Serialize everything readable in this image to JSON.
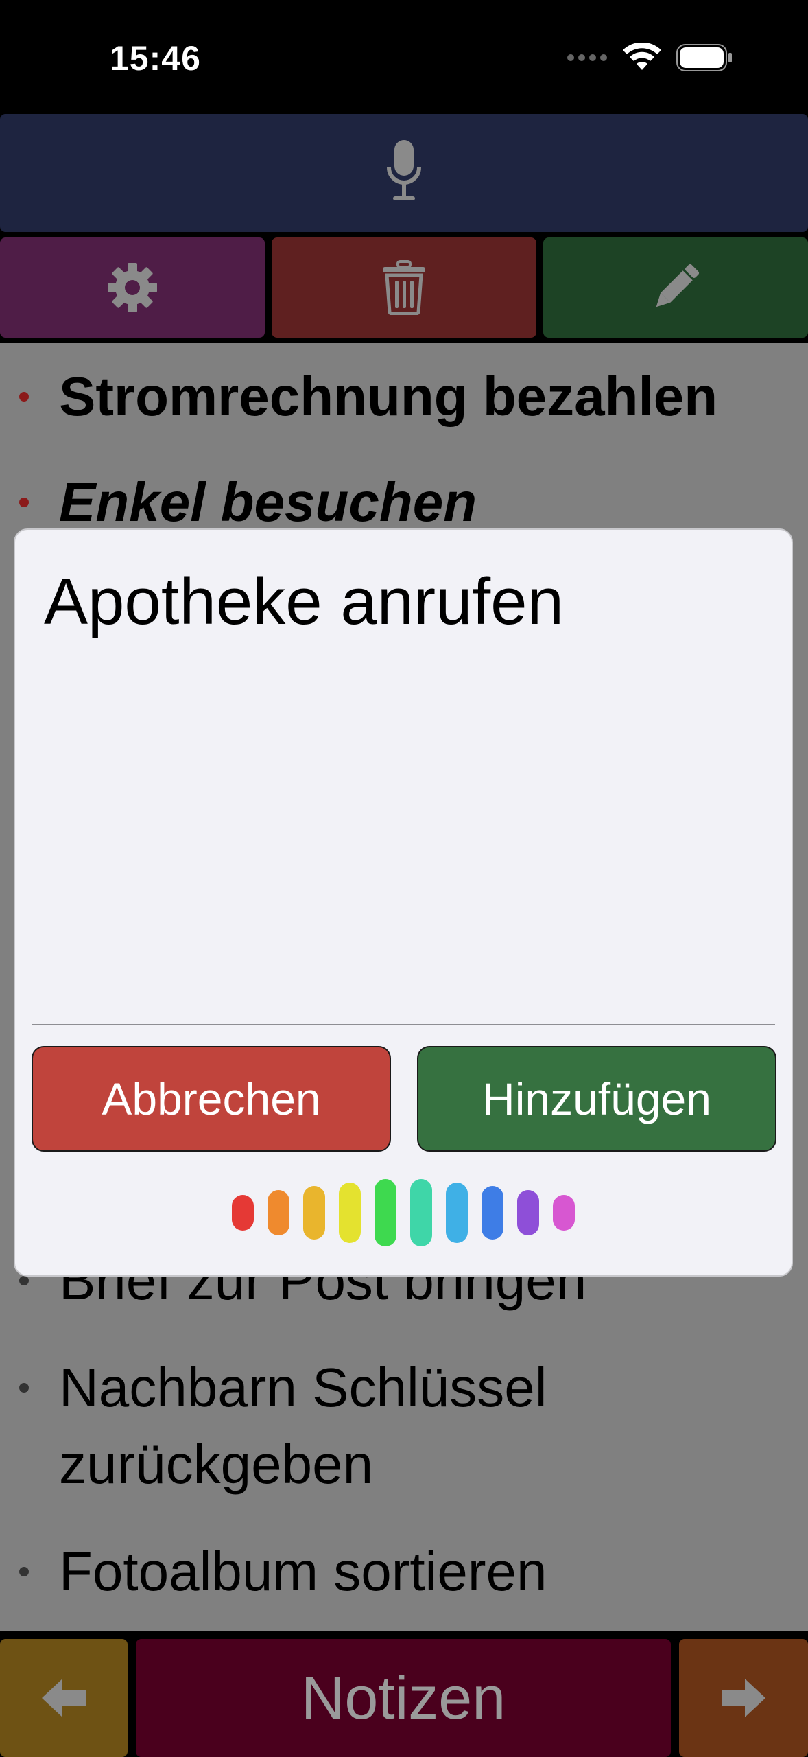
{
  "status": {
    "time": "15:46"
  },
  "toolbar": {
    "mic_icon": "microphone-icon",
    "settings_icon": "gear-icon",
    "trash_icon": "trash-icon",
    "edit_icon": "pencil-icon"
  },
  "notes": [
    {
      "text": "Stromrechnung bezahlen",
      "bullet_color": "#8b1a1a"
    },
    {
      "text": "Enkel besuchen",
      "bullet_color": "#8b1a1a"
    },
    {
      "text": "Brief zur Post bringen",
      "bullet_color": "#333333"
    },
    {
      "text": "Nachbarn Schlüssel zurückgeben",
      "bullet_color": "#333333"
    },
    {
      "text": "Fotoalbum sortieren",
      "bullet_color": "#333333"
    }
  ],
  "dialog": {
    "input_value": "Apotheke anrufen",
    "cancel_label": "Abbrechen",
    "add_label": "Hinzufügen",
    "wave_colors": [
      "#e53935",
      "#ef8a2e",
      "#e9b52d",
      "#e4e22f",
      "#3ed94f",
      "#3fd6a8",
      "#3fb0e6",
      "#3e7de6",
      "#8e4fd8",
      "#d757d1"
    ]
  },
  "bottom_nav": {
    "left_icon": "arrow-left-icon",
    "title": "Notizen",
    "right_icon": "arrow-right-icon"
  }
}
